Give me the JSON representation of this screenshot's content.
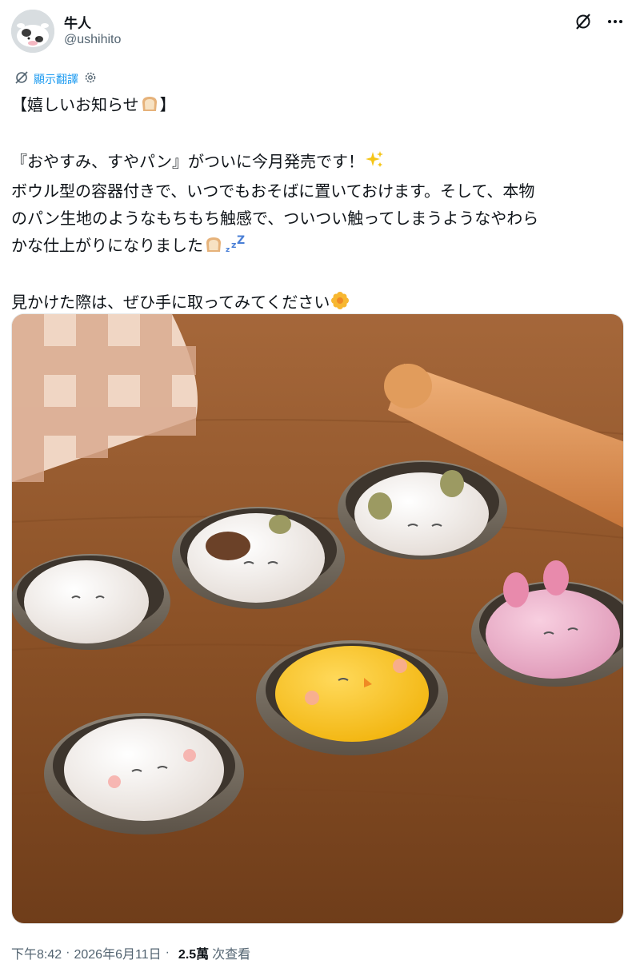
{
  "author": {
    "display_name": "牛人",
    "handle": "@ushihito",
    "avatar_icon": "cow-avatar-icon"
  },
  "header_icons": [
    "grok-slash-icon",
    "more-dots-icon"
  ],
  "translate": {
    "label": "顯示翻譯",
    "icon": "translate-icon",
    "settings_icon": "gear-icon",
    "color": "#1d9bf0"
  },
  "tweet": {
    "line1": "【嬉しいお知らせ",
    "line1_end": "】",
    "line2": "『おやすみ、すやパン』がついに今月発売です！",
    "line3": "ボウル型の容器付きで、いつでもおそばに置いておけます。そして、本物",
    "line4": "のパン生地のようなもちもち触感で、ついつい触ってしまうようなやわら",
    "line5": "かな仕上がりになりました",
    "line6": "見かけた際は、ぜひ手に取ってみてください"
  },
  "emojis": {
    "bread": "bread-emoji",
    "sparkles": "sparkles-emoji",
    "zzz": "zzz-emoji",
    "blossom": "blossom-emoji"
  },
  "meta": {
    "time": "下午8:42",
    "date": "2026年6月11日",
    "views": "2.5萬",
    "views_label": "次查看"
  },
  "photo": {
    "subject": "tweet-photo"
  }
}
